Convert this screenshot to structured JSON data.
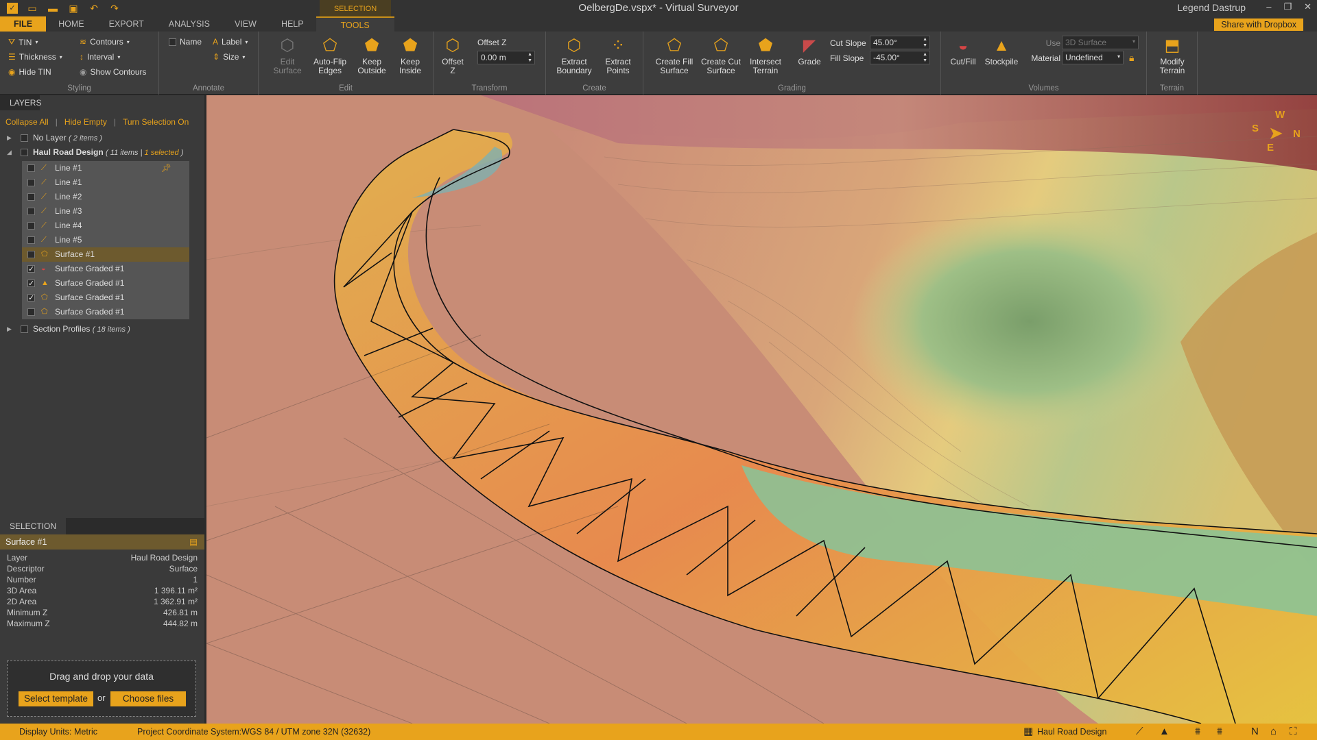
{
  "app": {
    "title": "OelbergDe.vspx* - Virtual Surveyor",
    "user": "Legend Dastrup",
    "share_label": "Share with Dropbox",
    "accent_color": "#e8a31c"
  },
  "tabs": {
    "context_label": "SELECTION",
    "file": "FILE",
    "home": "HOME",
    "export": "EXPORT",
    "analysis": "ANALYSIS",
    "view": "VIEW",
    "help": "HELP",
    "tools": "TOOLS"
  },
  "ribbon": {
    "styling": {
      "label": "Styling",
      "tin": "TIN",
      "thickness": "Thickness",
      "hide_tin": "Hide TIN",
      "contours": "Contours",
      "interval": "Interval",
      "show_contours": "Show Contours"
    },
    "annotate": {
      "label": "Annotate",
      "name": "Name",
      "label_btn": "Label",
      "size": "Size"
    },
    "edit": {
      "label": "Edit",
      "edit_surface": [
        "Edit",
        "Surface"
      ],
      "auto_flip": [
        "Auto-Flip",
        "Edges"
      ],
      "keep_outside": [
        "Keep",
        "Outside"
      ],
      "keep_inside": [
        "Keep",
        "Inside"
      ]
    },
    "transform": {
      "label": "Transform",
      "offset_z_btn": [
        "Offset",
        "Z"
      ],
      "offset_z_label": "Offset Z",
      "offset_z_value": "0.00 m"
    },
    "create": {
      "label": "Create",
      "extract_boundary": [
        "Extract",
        "Boundary"
      ],
      "extract_points": [
        "Extract",
        "Points"
      ]
    },
    "grading": {
      "label": "Grading",
      "create_fill": [
        "Create Fill",
        "Surface"
      ],
      "create_cut": [
        "Create Cut",
        "Surface"
      ],
      "intersect": [
        "Intersect",
        "Terrain"
      ],
      "grade": "Grade",
      "cut_slope_label": "Cut Slope",
      "cut_slope_value": "45.00°",
      "fill_slope_label": "Fill Slope",
      "fill_slope_value": "-45.00°"
    },
    "volumes": {
      "label": "Volumes",
      "cut_fill": "Cut/Fill",
      "stockpile": "Stockpile",
      "use_label": "Use",
      "use_value": "3D Surface",
      "material_label": "Material",
      "material_value": "Undefined"
    },
    "terrain": {
      "label": "Terrain",
      "modify": [
        "Modify",
        "Terrain"
      ]
    }
  },
  "layers": {
    "header": "LAYERS",
    "collapse_all": "Collapse All",
    "hide_empty": "Hide Empty",
    "turn_selection_on": "Turn Selection On",
    "no_layer": {
      "name": "No Layer",
      "count": "2 items"
    },
    "haul_road": {
      "name": "Haul Road Design",
      "count": "11 items",
      "selected": "1 selected"
    },
    "items": [
      {
        "name": "Line #1",
        "checked": false,
        "selected": false
      },
      {
        "name": "Line #1",
        "checked": false,
        "selected": false
      },
      {
        "name": "Line #2",
        "checked": false,
        "selected": false
      },
      {
        "name": "Line #3",
        "checked": false,
        "selected": false
      },
      {
        "name": "Line #4",
        "checked": false,
        "selected": false
      },
      {
        "name": "Line #5",
        "checked": false,
        "selected": false
      },
      {
        "name": "Surface #1",
        "checked": false,
        "selected": true
      },
      {
        "name": "Surface Graded #1",
        "checked": true,
        "selected": false
      },
      {
        "name": "Surface Graded #1",
        "checked": true,
        "selected": false
      },
      {
        "name": "Surface Graded #1",
        "checked": true,
        "selected": false
      },
      {
        "name": "Surface Graded #1",
        "checked": false,
        "selected": false
      }
    ],
    "section_profiles": {
      "name": "Section Profiles",
      "count": "18 items"
    }
  },
  "selection": {
    "header": "SELECTION",
    "title": "Surface #1",
    "props": [
      {
        "k": "Layer",
        "v": "Haul Road Design"
      },
      {
        "k": "Descriptor",
        "v": "Surface"
      },
      {
        "k": "Number",
        "v": "1"
      },
      {
        "k": "3D Area",
        "v": "1 396.11 m²"
      },
      {
        "k": "2D Area",
        "v": "1 362.91 m²"
      },
      {
        "k": "Minimum Z",
        "v": "426.81 m"
      },
      {
        "k": "Maximum Z",
        "v": "444.82 m"
      }
    ]
  },
  "dropzone": {
    "text": "Drag and drop your data",
    "select_template": "Select template",
    "or": "or",
    "choose_files": "Choose files"
  },
  "compass": {
    "w": "W",
    "s": "S",
    "n": "N",
    "e": "E"
  },
  "status": {
    "display_units_label": "Display Units:",
    "display_units_value": "Metric",
    "crs_label": "Project Coordinate System:",
    "crs_value": "WGS 84 / UTM zone 32N (32632)",
    "active_layer": "Haul Road Design"
  }
}
